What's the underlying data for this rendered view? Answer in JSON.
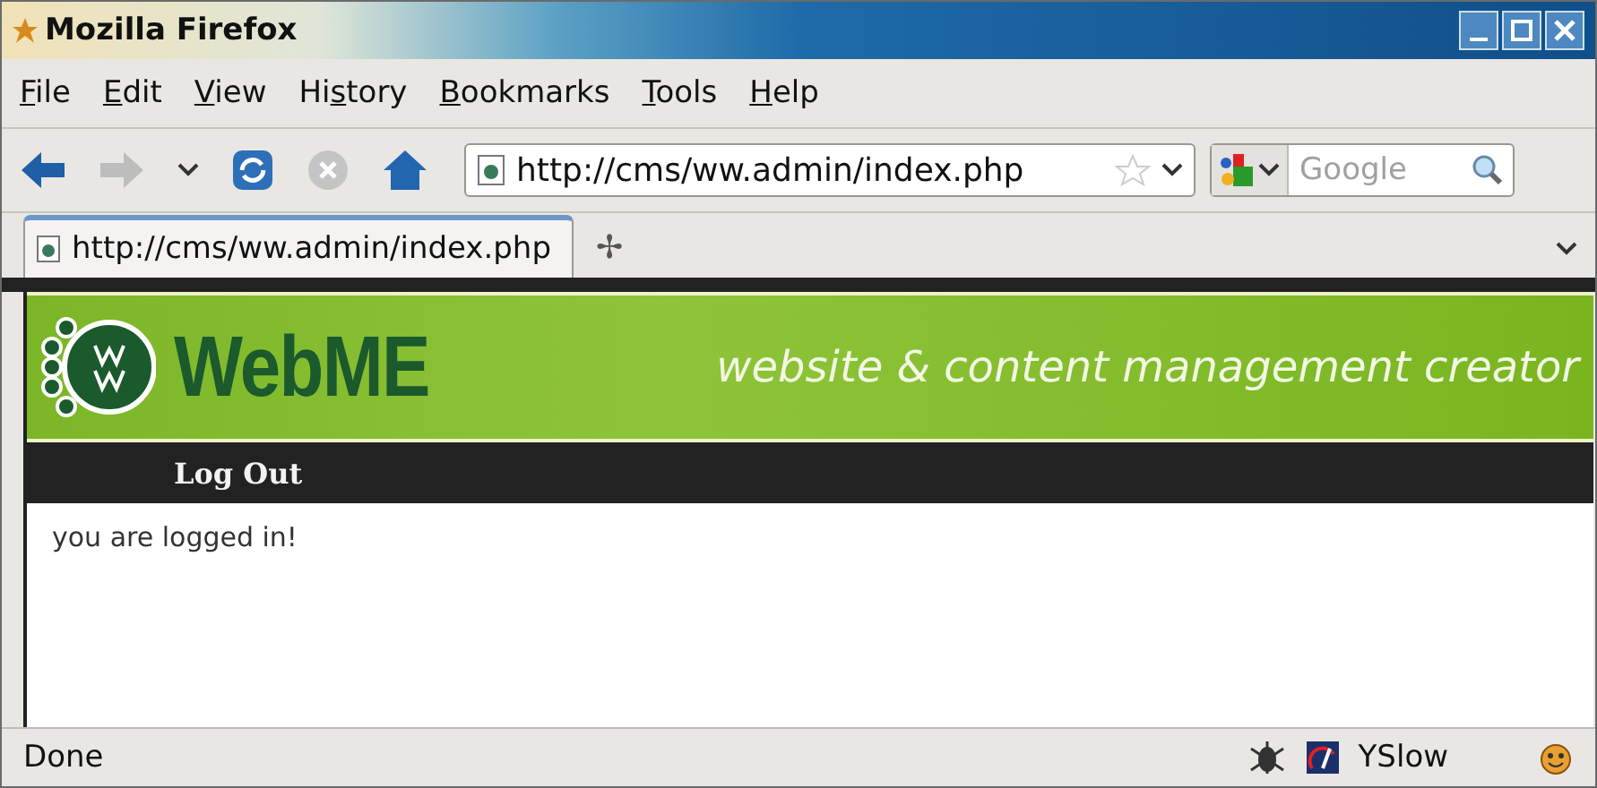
{
  "window": {
    "title": "Mozilla Firefox"
  },
  "menu": [
    {
      "key": "F",
      "post": "ile"
    },
    {
      "key": "E",
      "post": "dit"
    },
    {
      "key": "V",
      "post": "iew"
    },
    {
      "pre": "Hi",
      "key": "s",
      "post": "tory"
    },
    {
      "key": "B",
      "post": "ookmarks"
    },
    {
      "key": "T",
      "post": "ools"
    },
    {
      "key": "H",
      "post": "elp"
    }
  ],
  "toolbar": {
    "back_disabled": false,
    "forward_disabled": true,
    "stop_disabled": true,
    "url": "http://cms/ww.admin/index.php",
    "search_placeholder": "Google"
  },
  "tabs": [
    {
      "label": "http://cms/ww.admin/index.php",
      "selected": true
    }
  ],
  "new_tab": "✢",
  "site": {
    "logo": "WebME",
    "tagline": "website & content management creator",
    "nav": [
      "Log Out"
    ],
    "message": "you are logged in!"
  },
  "status_bar": {
    "text": "Done",
    "yslow": "YSlow"
  }
}
